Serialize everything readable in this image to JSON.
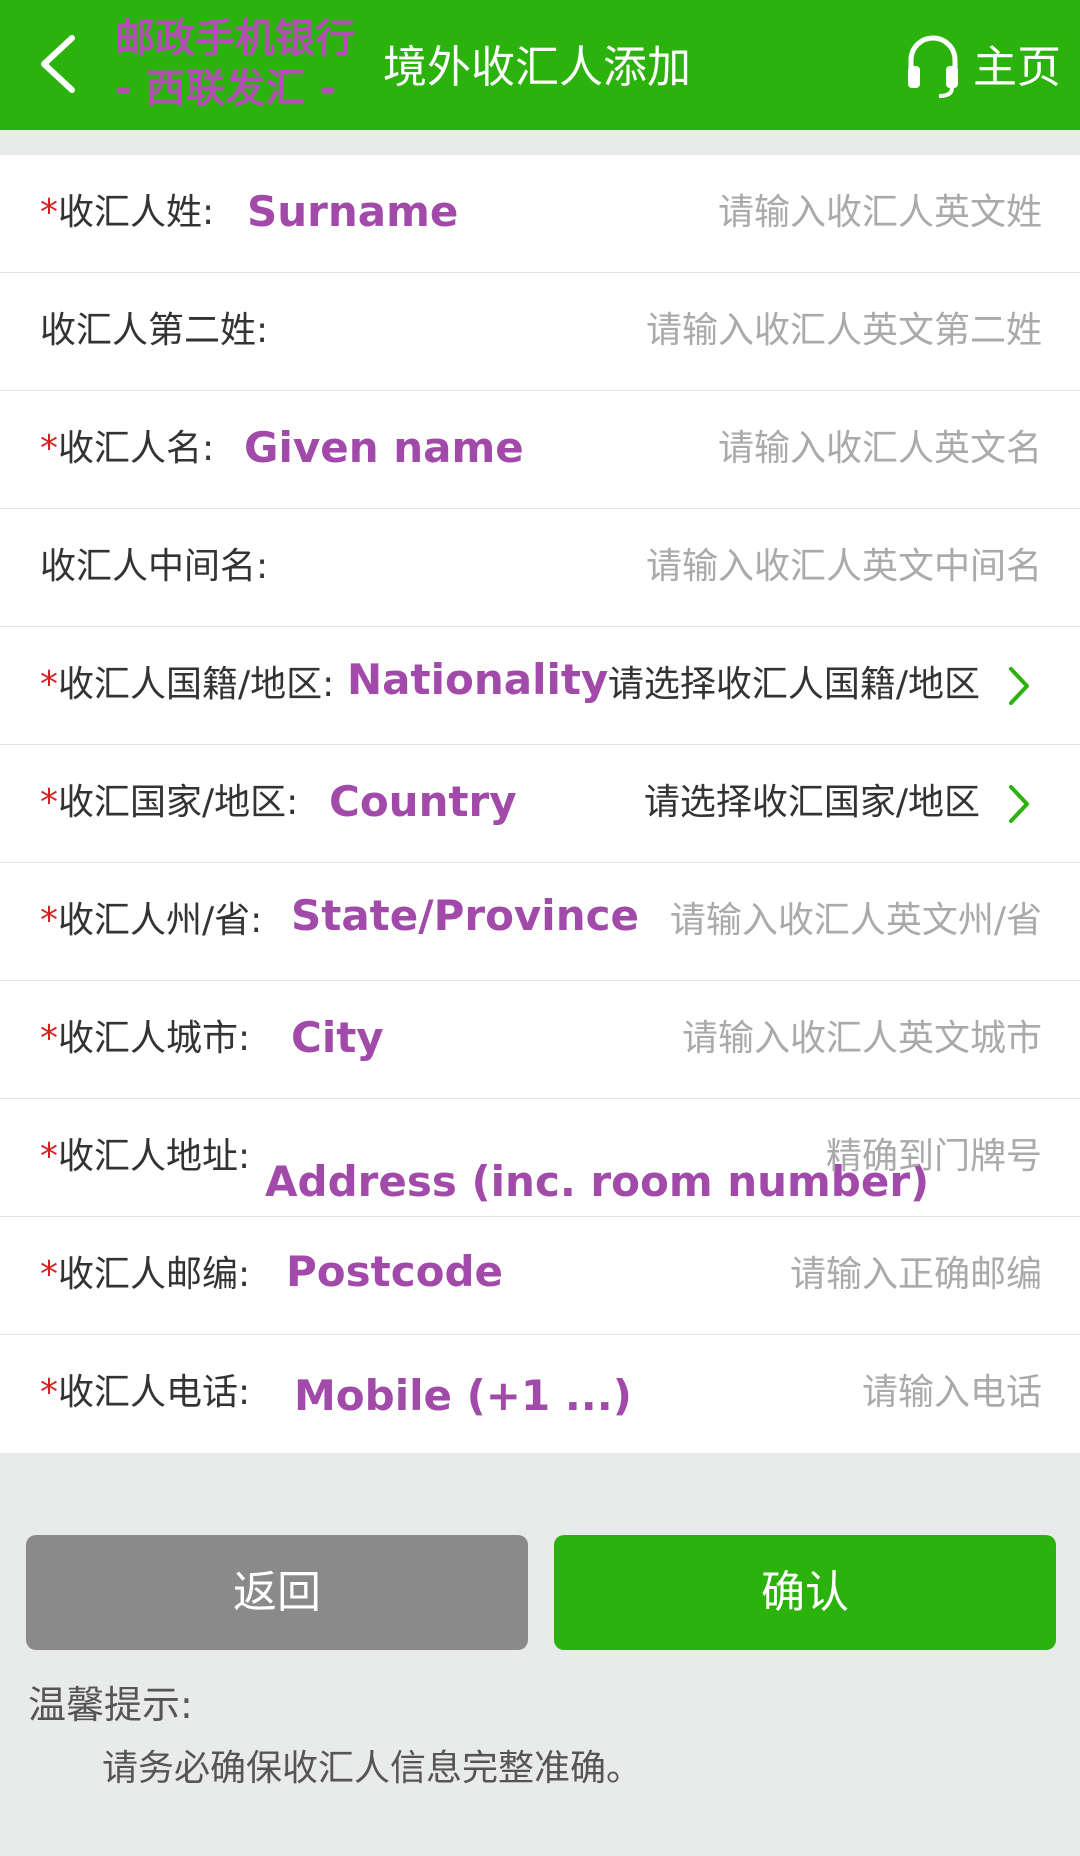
{
  "header": {
    "overlay_line1": "邮政手机银行",
    "overlay_line2": "- 西联发汇 -",
    "title": "境外收汇人添加",
    "home_label": "主页"
  },
  "fields": [
    {
      "required": "*",
      "label": "收汇人姓:",
      "placeholder": "请输入收汇人英文姓",
      "annotation": "Surname"
    },
    {
      "required": "",
      "label": "收汇人第二姓:",
      "placeholder": "请输入收汇人英文第二姓",
      "annotation": ""
    },
    {
      "required": "*",
      "label": "收汇人名:",
      "placeholder": "请输入收汇人英文名",
      "annotation": "Given name"
    },
    {
      "required": "",
      "label": "收汇人中间名:",
      "placeholder": "请输入收汇人英文中间名",
      "annotation": ""
    },
    {
      "required": "*",
      "label": "收汇人国籍/地区:",
      "placeholder": "请选择收汇人国籍/地区",
      "annotation": "Nationality"
    },
    {
      "required": "*",
      "label": "收汇国家/地区:",
      "placeholder": "请选择收汇国家/地区",
      "annotation": "Country"
    },
    {
      "required": "*",
      "label": "收汇人州/省:",
      "placeholder": "请输入收汇人英文州/省",
      "annotation": "State/Province"
    },
    {
      "required": "*",
      "label": "收汇人城市:",
      "placeholder": "请输入收汇人英文城市",
      "annotation": "City"
    },
    {
      "required": "*",
      "label": "收汇人地址:",
      "placeholder": "精确到门牌号",
      "annotation": "Address (inc. room number)"
    },
    {
      "required": "*",
      "label": "收汇人邮编:",
      "placeholder": "请输入正确邮编",
      "annotation": "Postcode"
    },
    {
      "required": "*",
      "label": "收汇人电话:",
      "placeholder": "请输入电话",
      "annotation": "Mobile (+1 ...)"
    }
  ],
  "buttons": {
    "back_label": "返回",
    "confirm_label": "确认"
  },
  "tips": {
    "title": "温馨提示:",
    "text": "请务必确保收汇人信息完整准确。"
  },
  "colors": {
    "brand_green": "#2bb20d",
    "annotation_purple": "#a14aa9",
    "required_red": "#d32222"
  }
}
